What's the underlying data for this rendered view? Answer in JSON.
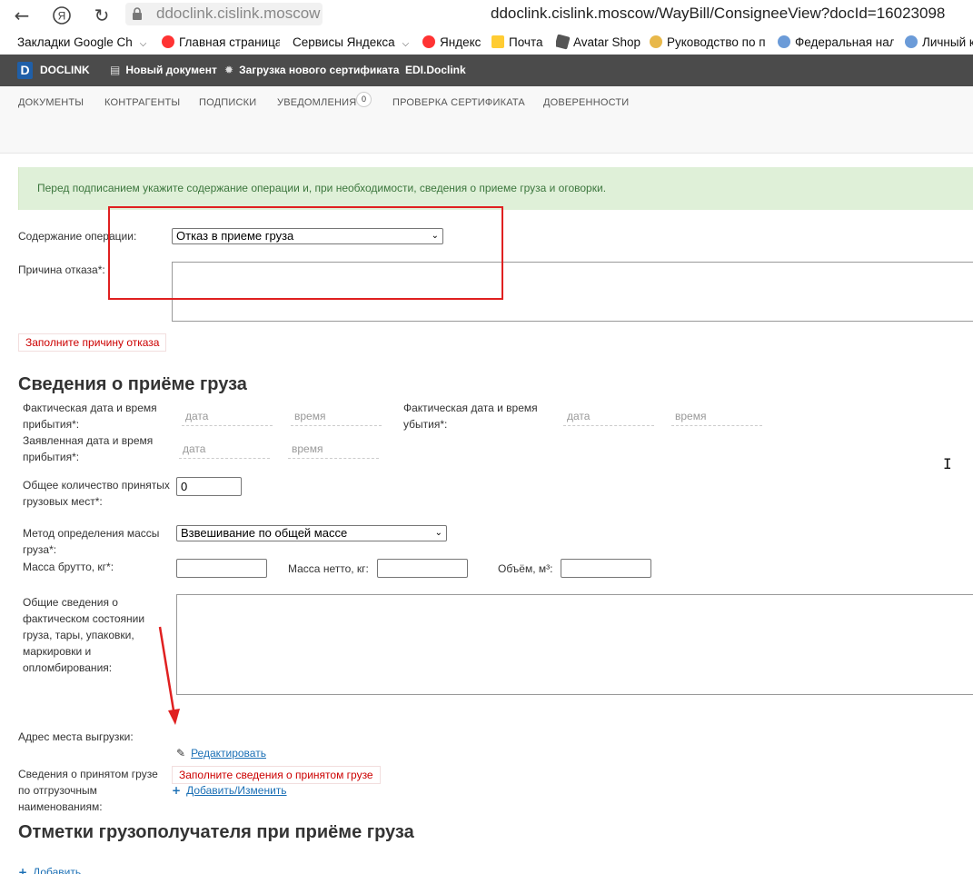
{
  "browser": {
    "url_host": "ddoclink.cislink.moscow",
    "url_full": "ddoclink.cislink.moscow/WayBill/ConsigneeView?docId=16023098",
    "bookmarks": [
      {
        "label": "Закладки Google Ch",
        "icon": "folder-icon",
        "chevron": true
      },
      {
        "label": "Главная страница",
        "icon": "yandex-icon",
        "chevron": false
      },
      {
        "label": "Сервисы Яндекса",
        "icon": "none",
        "chevron": true
      },
      {
        "label": "Яндекс",
        "icon": "yandex-icon",
        "chevron": false
      },
      {
        "label": "Почта",
        "icon": "mail-icon",
        "chevron": false
      },
      {
        "label": "Avatar Shop",
        "icon": "roblox-icon",
        "chevron": false
      },
      {
        "label": "Руководство по п",
        "icon": "gear-icon",
        "chevron": false
      },
      {
        "label": "Федеральная нал",
        "icon": "emblem-icon",
        "chevron": false
      },
      {
        "label": "Личный к",
        "icon": "emblem-icon",
        "chevron": false
      }
    ]
  },
  "app": {
    "logo_letter": "D",
    "logo_text": "DOCLINK",
    "new_doc": "Новый документ",
    "upload_cert": "Загрузка нового сертификата",
    "edi": "EDI.Doclink"
  },
  "tabs": {
    "documents": "ДОКУМЕНТЫ",
    "contragents": "КОНТРАГЕНТЫ",
    "subscriptions": "ПОДПИСКИ",
    "notifications": "УВЕДОМЛЕНИЯ",
    "notifications_count": "0",
    "check_cert": "ПРОВЕРКА СЕРТИФИКАТА",
    "powers": "ДОВЕРЕННОСТИ"
  },
  "alert_text": "Перед подписанием укажите содержание операции и, при необходимости, сведения о приеме груза и оговорки.",
  "operation": {
    "label": "Содержание операции:",
    "value": "Отказ в приеме груза",
    "reason_label": "Причина отказа*:",
    "reason_error": "Заполните причину отказа"
  },
  "cargo": {
    "title": "Сведения о приёме груза",
    "arrival_actual_label": "Фактическая дата и время прибытия*:",
    "departure_actual_label": "Фактическая дата и время убытия*:",
    "arrival_declared_label": "Заявленная дата и время прибытия*:",
    "date_placeholder": "дата",
    "time_placeholder": "время",
    "places_label": "Общее количество принятых грузовых мест*:",
    "places_value": "0",
    "mass_method_label": "Метод определения массы груза*:",
    "mass_method_value": "Взвешивание по общей массе",
    "gross_label": "Масса брутто, кг*:",
    "net_label": "Масса нетто, кг:",
    "volume_label": "Объём, м³:",
    "condition_label": "Общие сведения о фактическом состоянии груза, тары, упаковки, маркировки и опломбирования:",
    "unload_address_label": "Адрес места выгрузки:",
    "edit_link": "Редактировать",
    "goods_label": "Сведения о принятом грузе по отгрузочным наименованиям:",
    "goods_error": "Заполните сведения о принятом грузе",
    "add_change_link": "Добавить/Изменить"
  },
  "consignee": {
    "title": "Отметки грузополучателя при приёме груза",
    "add_link": "Добавить"
  },
  "colors": {
    "app_bar": "#4b4b4b",
    "alert_bg": "#dff0d8",
    "alert_text": "#3c763d",
    "error": "#cc0000",
    "link": "#1a6fb5",
    "annotation": "#e02020"
  }
}
